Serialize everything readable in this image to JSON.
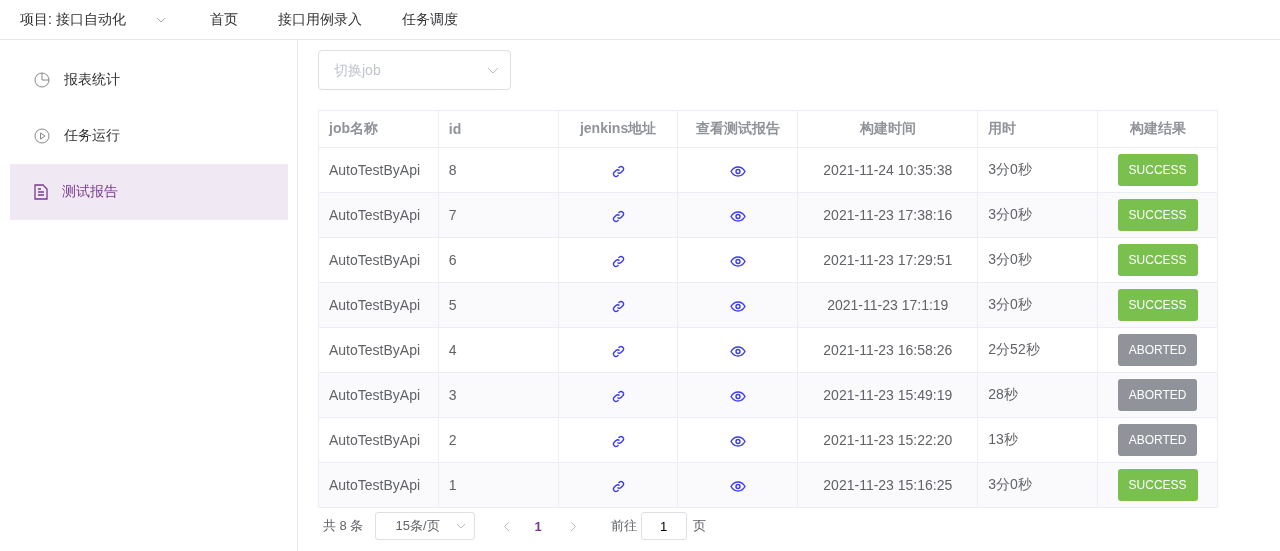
{
  "top_nav": {
    "project": "项目: 接口自动化",
    "items": [
      {
        "label": "首页"
      },
      {
        "label": "接口用例录入"
      },
      {
        "label": "任务调度"
      }
    ]
  },
  "sidebar": {
    "items": [
      {
        "label": "报表统计",
        "selected": false
      },
      {
        "label": "任务运行",
        "selected": false
      },
      {
        "label": "测试报告",
        "selected": true
      }
    ]
  },
  "job_select": {
    "placeholder": "切换job"
  },
  "table": {
    "columns": [
      {
        "label": "job名称"
      },
      {
        "label": "id"
      },
      {
        "label": "jenkins地址"
      },
      {
        "label": "查看测试报告"
      },
      {
        "label": "构建时间"
      },
      {
        "label": "用时"
      },
      {
        "label": "构建结果"
      }
    ],
    "rows": [
      {
        "job": "AutoTestByApi",
        "id": "8",
        "time": "2021-11-24 10:35:38",
        "duration": "3分0秒",
        "result": "SUCCESS",
        "kind": "success"
      },
      {
        "job": "AutoTestByApi",
        "id": "7",
        "time": "2021-11-23 17:38:16",
        "duration": "3分0秒",
        "result": "SUCCESS",
        "kind": "success"
      },
      {
        "job": "AutoTestByApi",
        "id": "6",
        "time": "2021-11-23 17:29:51",
        "duration": "3分0秒",
        "result": "SUCCESS",
        "kind": "success"
      },
      {
        "job": "AutoTestByApi",
        "id": "5",
        "time": "2021-11-23 17:1:19",
        "duration": "3分0秒",
        "result": "SUCCESS",
        "kind": "success"
      },
      {
        "job": "AutoTestByApi",
        "id": "4",
        "time": "2021-11-23 16:58:26",
        "duration": "2分52秒",
        "result": "ABORTED",
        "kind": "aborted"
      },
      {
        "job": "AutoTestByApi",
        "id": "3",
        "time": "2021-11-23 15:49:19",
        "duration": "28秒",
        "result": "ABORTED",
        "kind": "aborted"
      },
      {
        "job": "AutoTestByApi",
        "id": "2",
        "time": "2021-11-23 15:22:20",
        "duration": "13秒",
        "result": "ABORTED",
        "kind": "aborted"
      },
      {
        "job": "AutoTestByApi",
        "id": "1",
        "time": "2021-11-23 15:16:25",
        "duration": "3分0秒",
        "result": "SUCCESS",
        "kind": "success"
      }
    ]
  },
  "pagination": {
    "total": "共 8 条",
    "page_size": "15条/页",
    "pages": [
      {
        "label": "1",
        "selected": true
      }
    ],
    "goto_label": "前往",
    "goto_value": "1",
    "page_suffix": "页"
  }
}
